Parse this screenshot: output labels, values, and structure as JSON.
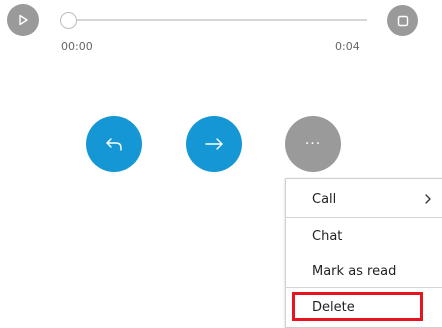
{
  "player": {
    "current_time": "00:00",
    "total_time": "0:04",
    "progress": 0
  },
  "icons": {
    "play": "play-icon",
    "stop": "stop-icon",
    "reply": "reply-arrow-icon",
    "forward": "forward-arrow-icon",
    "more": "more-dots-icon",
    "submenu": "chevron-right-icon"
  },
  "actions": {
    "more_dots": "···"
  },
  "menu": {
    "items": [
      {
        "label": "Call"
      },
      {
        "label": "Chat"
      },
      {
        "label": "Mark as read"
      },
      {
        "label": "Delete"
      }
    ]
  },
  "colors": {
    "accent_blue": "#1597d6",
    "gray_button": "#9a9a9a",
    "highlight_red": "#e5141e"
  }
}
